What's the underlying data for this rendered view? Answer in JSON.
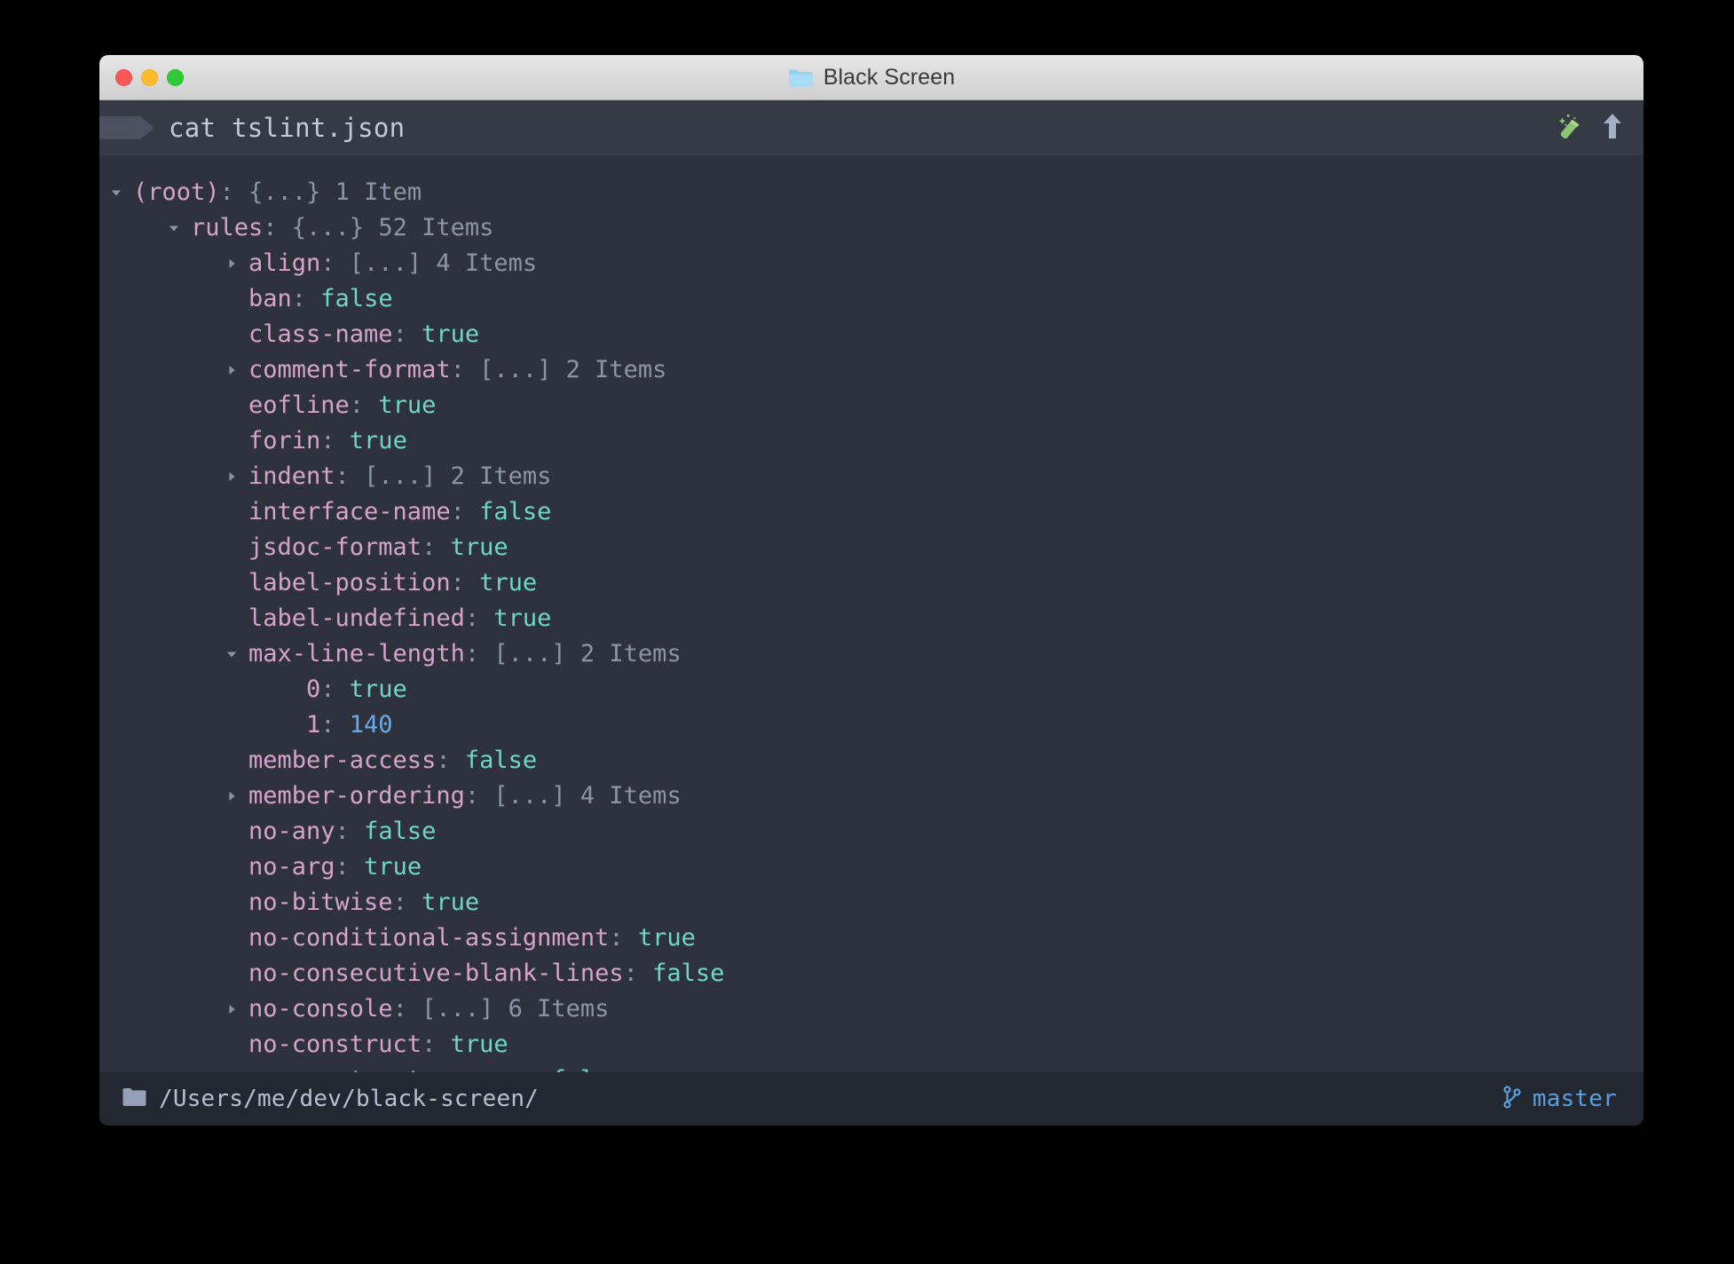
{
  "window": {
    "title": "Black Screen",
    "title_icon": "folder-icon",
    "controls": {
      "close_label": "close",
      "minimize_label": "minimize",
      "zoom_label": "zoom"
    },
    "colors": {
      "close": "#f9565a",
      "minimize": "#fcbb2e",
      "zoom": "#2dc937",
      "titlebar": "#dbdbdb",
      "prompt_bg": "#353a45",
      "content_bg": "#2e323c",
      "status_bg": "#23272f",
      "key": "#d7a3cb",
      "value": "#6fd7c5",
      "number": "#6aa9e9",
      "punctuation": "#8b95a6",
      "accent_blue": "#5a9fe0",
      "wand_green": "#8cc571"
    }
  },
  "prompt": {
    "command": "cat tslint.json",
    "icons": [
      {
        "name": "magic-wand-icon",
        "label": "autocomplete"
      },
      {
        "name": "arrow-up-icon",
        "label": "scroll to top"
      }
    ]
  },
  "tree": {
    "rows": [
      {
        "indent": 0,
        "toggle": "expanded",
        "key": "(root)",
        "sep": ": ",
        "brace": "{...}",
        "count": "1 Item",
        "value": ""
      },
      {
        "indent": 1,
        "toggle": "expanded",
        "key": "rules",
        "sep": ": ",
        "brace": "{...}",
        "count": "52 Items",
        "value": ""
      },
      {
        "indent": 2,
        "toggle": "collapsed",
        "key": "align",
        "sep": ": ",
        "brace": "[...]",
        "count": "4 Items",
        "value": ""
      },
      {
        "indent": 2,
        "toggle": "none",
        "key": "ban",
        "sep": ": ",
        "brace": "",
        "count": "",
        "value": "false"
      },
      {
        "indent": 2,
        "toggle": "none",
        "key": "class-name",
        "sep": ": ",
        "brace": "",
        "count": "",
        "value": "true"
      },
      {
        "indent": 2,
        "toggle": "collapsed",
        "key": "comment-format",
        "sep": ": ",
        "brace": "[...]",
        "count": "2 Items",
        "value": ""
      },
      {
        "indent": 2,
        "toggle": "none",
        "key": "eofline",
        "sep": ": ",
        "brace": "",
        "count": "",
        "value": "true"
      },
      {
        "indent": 2,
        "toggle": "none",
        "key": "forin",
        "sep": ": ",
        "brace": "",
        "count": "",
        "value": "true"
      },
      {
        "indent": 2,
        "toggle": "collapsed",
        "key": "indent",
        "sep": ": ",
        "brace": "[...]",
        "count": "2 Items",
        "value": ""
      },
      {
        "indent": 2,
        "toggle": "none",
        "key": "interface-name",
        "sep": ": ",
        "brace": "",
        "count": "",
        "value": "false"
      },
      {
        "indent": 2,
        "toggle": "none",
        "key": "jsdoc-format",
        "sep": ": ",
        "brace": "",
        "count": "",
        "value": "true"
      },
      {
        "indent": 2,
        "toggle": "none",
        "key": "label-position",
        "sep": ": ",
        "brace": "",
        "count": "",
        "value": "true"
      },
      {
        "indent": 2,
        "toggle": "none",
        "key": "label-undefined",
        "sep": ": ",
        "brace": "",
        "count": "",
        "value": "true"
      },
      {
        "indent": 2,
        "toggle": "expanded",
        "key": "max-line-length",
        "sep": ": ",
        "brace": "[...]",
        "count": "2 Items",
        "value": ""
      },
      {
        "indent": 3,
        "toggle": "none",
        "key": "0",
        "sep": ": ",
        "brace": "",
        "count": "",
        "value": "true"
      },
      {
        "indent": 3,
        "toggle": "none",
        "key": "1",
        "sep": ": ",
        "brace": "",
        "count": "",
        "value": "140",
        "numeric": true
      },
      {
        "indent": 2,
        "toggle": "none",
        "key": "member-access",
        "sep": ": ",
        "brace": "",
        "count": "",
        "value": "false"
      },
      {
        "indent": 2,
        "toggle": "collapsed",
        "key": "member-ordering",
        "sep": ": ",
        "brace": "[...]",
        "count": "4 Items",
        "value": ""
      },
      {
        "indent": 2,
        "toggle": "none",
        "key": "no-any",
        "sep": ": ",
        "brace": "",
        "count": "",
        "value": "false"
      },
      {
        "indent": 2,
        "toggle": "none",
        "key": "no-arg",
        "sep": ": ",
        "brace": "",
        "count": "",
        "value": "true"
      },
      {
        "indent": 2,
        "toggle": "none",
        "key": "no-bitwise",
        "sep": ": ",
        "brace": "",
        "count": "",
        "value": "true"
      },
      {
        "indent": 2,
        "toggle": "none",
        "key": "no-conditional-assignment",
        "sep": ": ",
        "brace": "",
        "count": "",
        "value": "true"
      },
      {
        "indent": 2,
        "toggle": "none",
        "key": "no-consecutive-blank-lines",
        "sep": ": ",
        "brace": "",
        "count": "",
        "value": "false"
      },
      {
        "indent": 2,
        "toggle": "collapsed",
        "key": "no-console",
        "sep": ": ",
        "brace": "[...]",
        "count": "6 Items",
        "value": ""
      },
      {
        "indent": 2,
        "toggle": "none",
        "key": "no-construct",
        "sep": ": ",
        "brace": "",
        "count": "",
        "value": "true"
      },
      {
        "indent": 2,
        "toggle": "none",
        "key": "no-constructor-vars",
        "sep": ": ",
        "brace": "",
        "count": "",
        "value": "false"
      }
    ]
  },
  "statusbar": {
    "path": "/Users/me/dev/black-screen/",
    "path_icon": "folder-icon",
    "branch": "master",
    "branch_icon": "git-branch-icon"
  }
}
